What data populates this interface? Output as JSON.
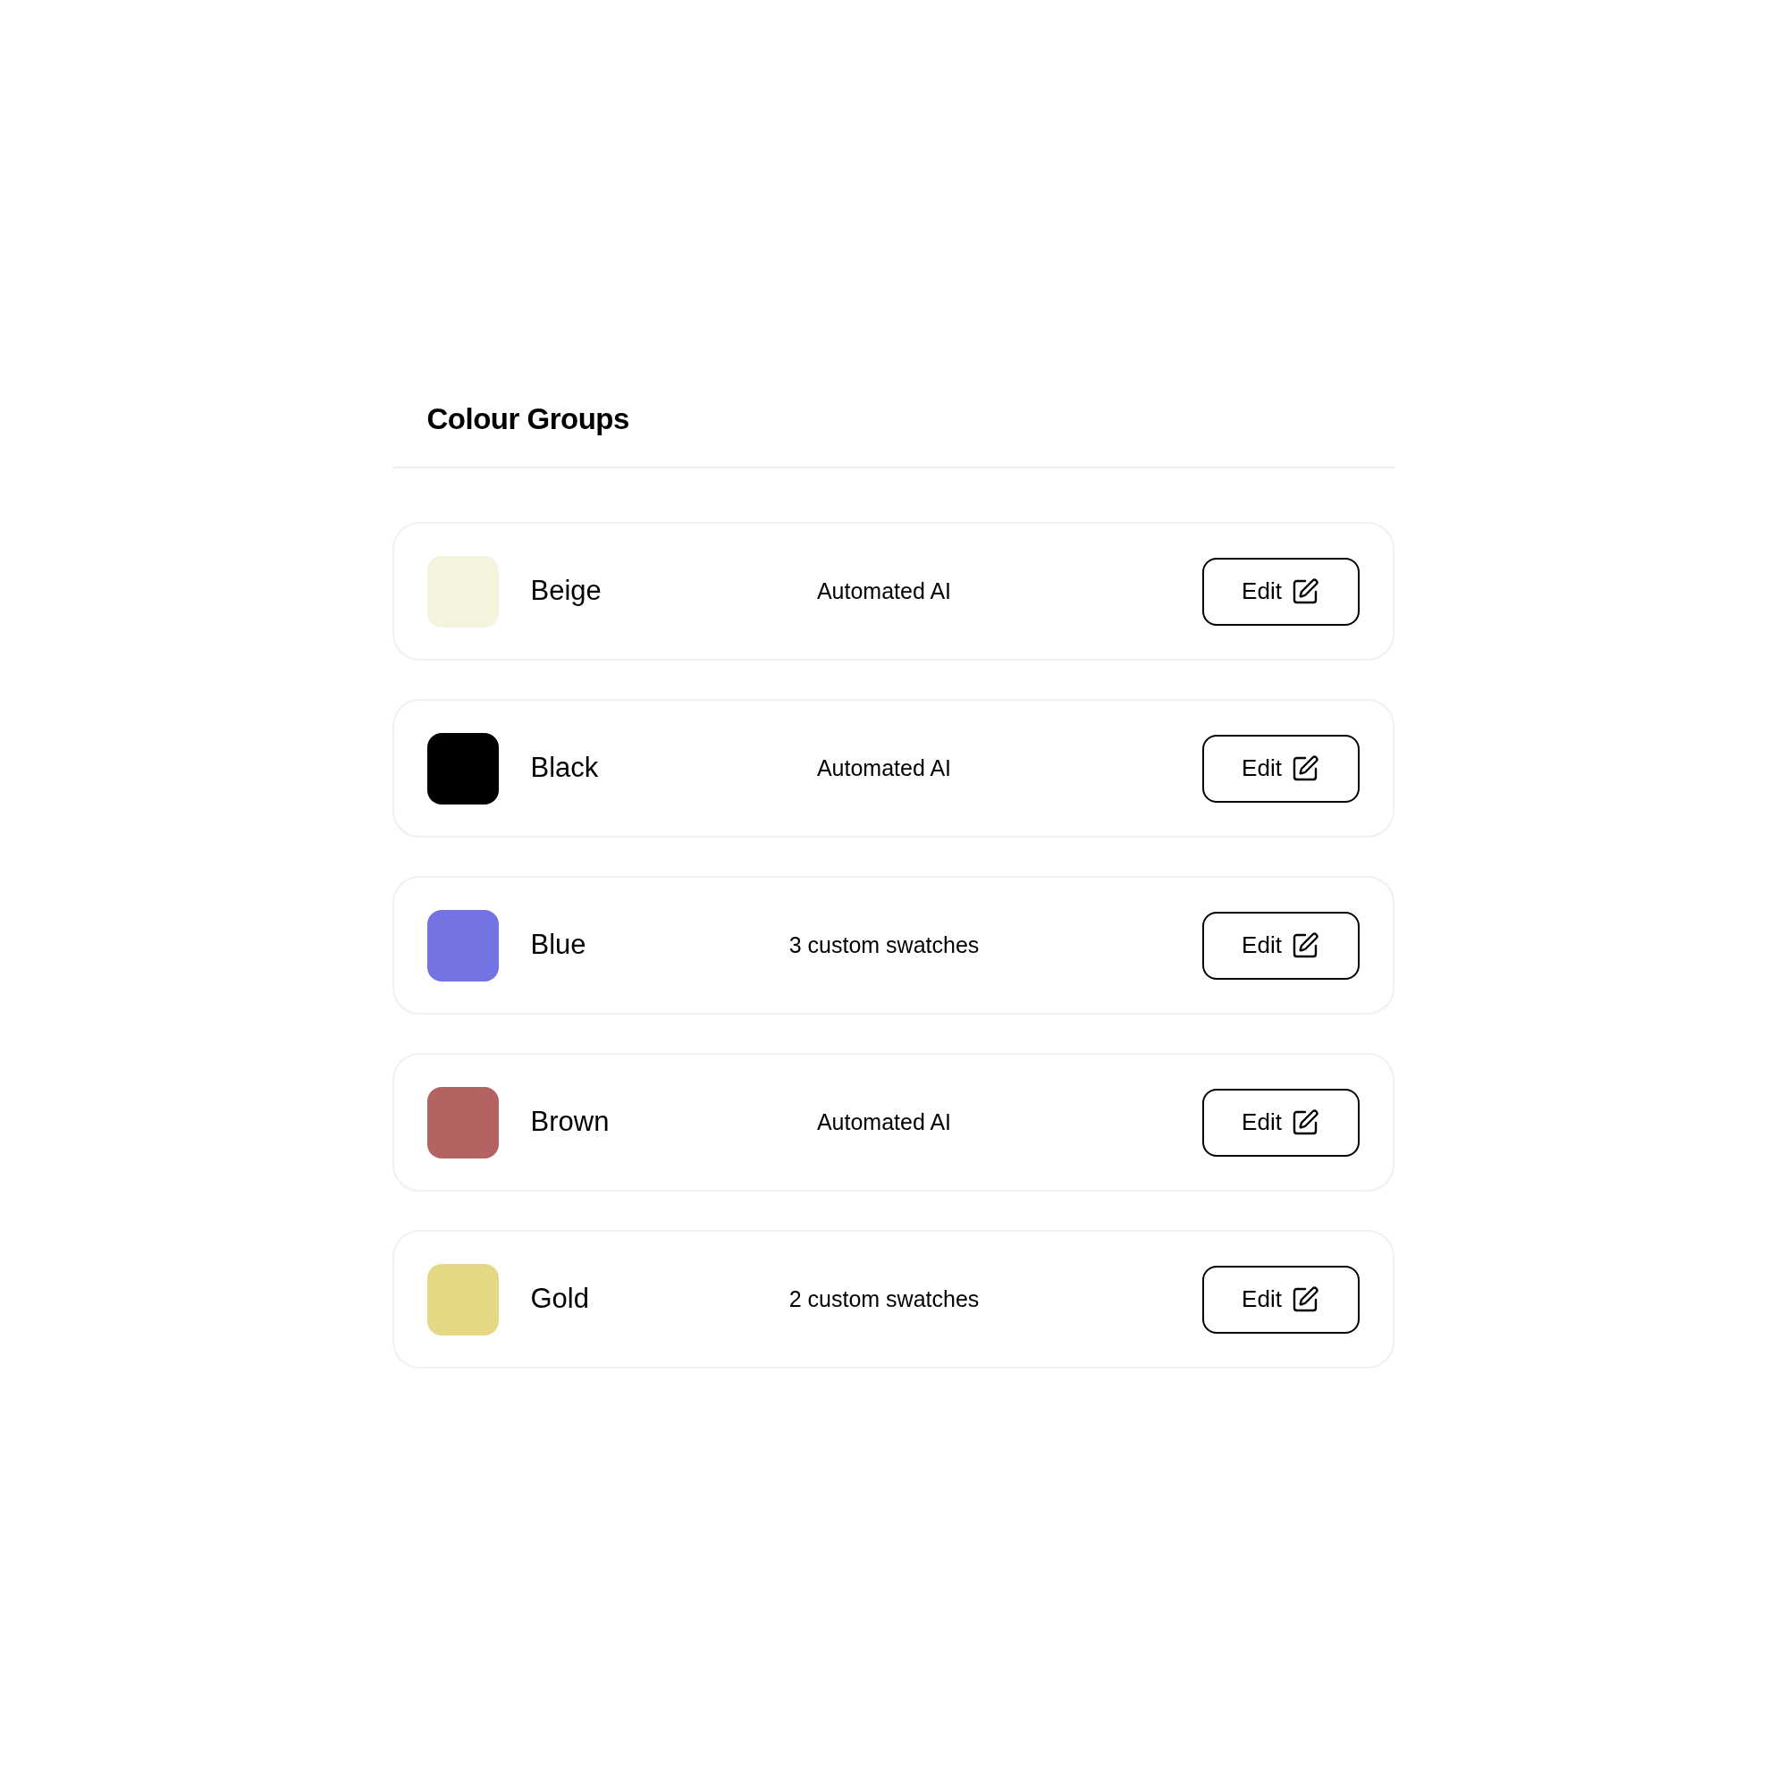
{
  "title": "Colour Groups",
  "groups": [
    {
      "name": "Beige",
      "color": "#f4f4de",
      "source": "Automated AI",
      "action": "Edit"
    },
    {
      "name": "Black",
      "color": "#000000",
      "source": "Automated AI",
      "action": "Edit"
    },
    {
      "name": "Blue",
      "color": "#7373e3",
      "source": "3 custom swatches",
      "action": "Edit"
    },
    {
      "name": "Brown",
      "color": "#b46262",
      "source": "Automated AI",
      "action": "Edit"
    },
    {
      "name": "Gold",
      "color": "#e5d884",
      "source": "2 custom swatches",
      "action": "Edit"
    }
  ]
}
